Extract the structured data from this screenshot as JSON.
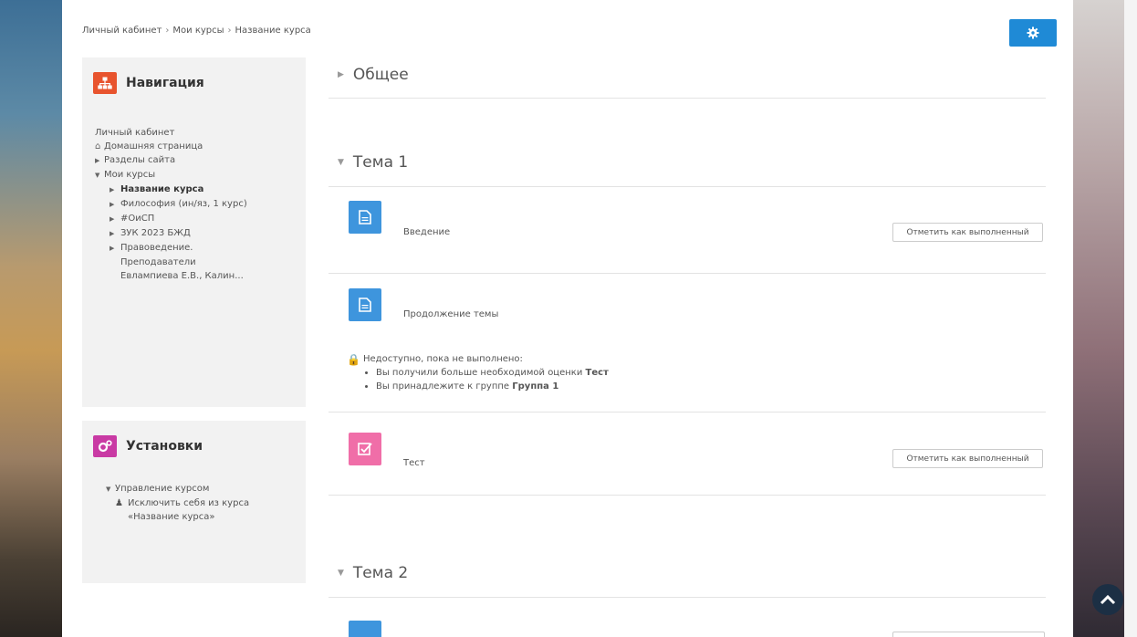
{
  "breadcrumb": {
    "items": [
      "Личный кабинет",
      "Мои курсы",
      "Название курса"
    ],
    "sep": "›"
  },
  "navigation": {
    "title": "Навигация",
    "dashboard": "Личный кабинет",
    "home": "Домашняя страница",
    "site_pages": "Разделы сайта",
    "my_courses": "Мои курсы",
    "courses": [
      "Название курса",
      "Философия (ин/яз, 1 курс)",
      "#ОиСП",
      "ЗУК 2023 БЖД",
      "Правоведение. Преподаватели Евлампиева Е.В., Калин..."
    ]
  },
  "settings": {
    "title": "Установки",
    "course_admin": "Управление курсом",
    "unenrol": "Исключить себя из курса «Название курса»"
  },
  "sections": {
    "general": "Общее",
    "topic1": "Тема 1",
    "topic2": "Тема 2"
  },
  "activities": {
    "intro": "Введение",
    "continuation": "Продолжение темы",
    "test": "Тест",
    "mark_complete": "Отметить как выполненный"
  },
  "restriction": {
    "header": "Недоступно, пока не выполнено:",
    "cond1_text": "Вы получили больше необходимой оценки",
    "cond1_bold": "Тест",
    "cond2_text": "Вы принадлежите к группе",
    "cond2_bold": "Группа 1"
  },
  "colors": {
    "accent": "#1f8ad6",
    "page_icon": "#3e95dd",
    "quiz_icon": "#f06ea8",
    "nav_icon": "#e8542e",
    "settings_icon": "#c93aa4"
  }
}
